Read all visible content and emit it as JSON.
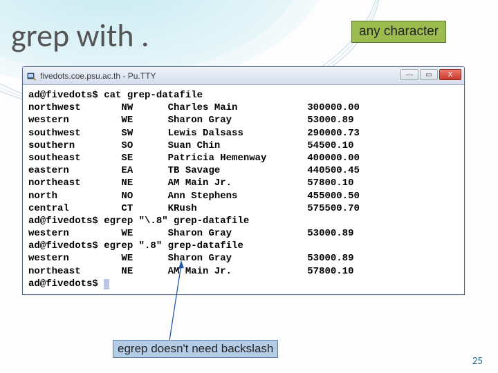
{
  "title": "grep with .",
  "any_character_label": "any character",
  "footnote_label": "egrep doesn't need backslash",
  "page_number": "25",
  "putty": {
    "title": "fivedots.coe.psu.ac.th - Pu.TTY",
    "min_btn": "—",
    "max_btn": "▭",
    "close_btn": "X"
  },
  "term": {
    "l01": "ad@fivedots$ cat grep-datafile",
    "l02": "northwest       NW      Charles Main            300000.00",
    "l03": "western         WE      Sharon Gray             53000.89",
    "l04": "southwest       SW      Lewis Dalsass           290000.73",
    "l05": "southern        SO      Suan Chin               54500.10",
    "l06": "southeast       SE      Patricia Hemenway       400000.00",
    "l07": "eastern         EA      TB Savage               440500.45",
    "l08": "northeast       NE      AM Main Jr.             57800.10",
    "l09": "north           NO      Ann Stephens            455000.50",
    "l10": "central         CT      KRush                   575500.70",
    "l11": "ad@fivedots$ egrep \"\\.8\" grep-datafile",
    "l12": "western         WE      Sharon Gray             53000.89",
    "l13": "ad@fivedots$ egrep \".8\" grep-datafile",
    "l14": "western         WE      Sharon Gray             53000.89",
    "l15": "northeast       NE      AM Main Jr.             57800.10",
    "l16": "ad@fivedots$ "
  }
}
